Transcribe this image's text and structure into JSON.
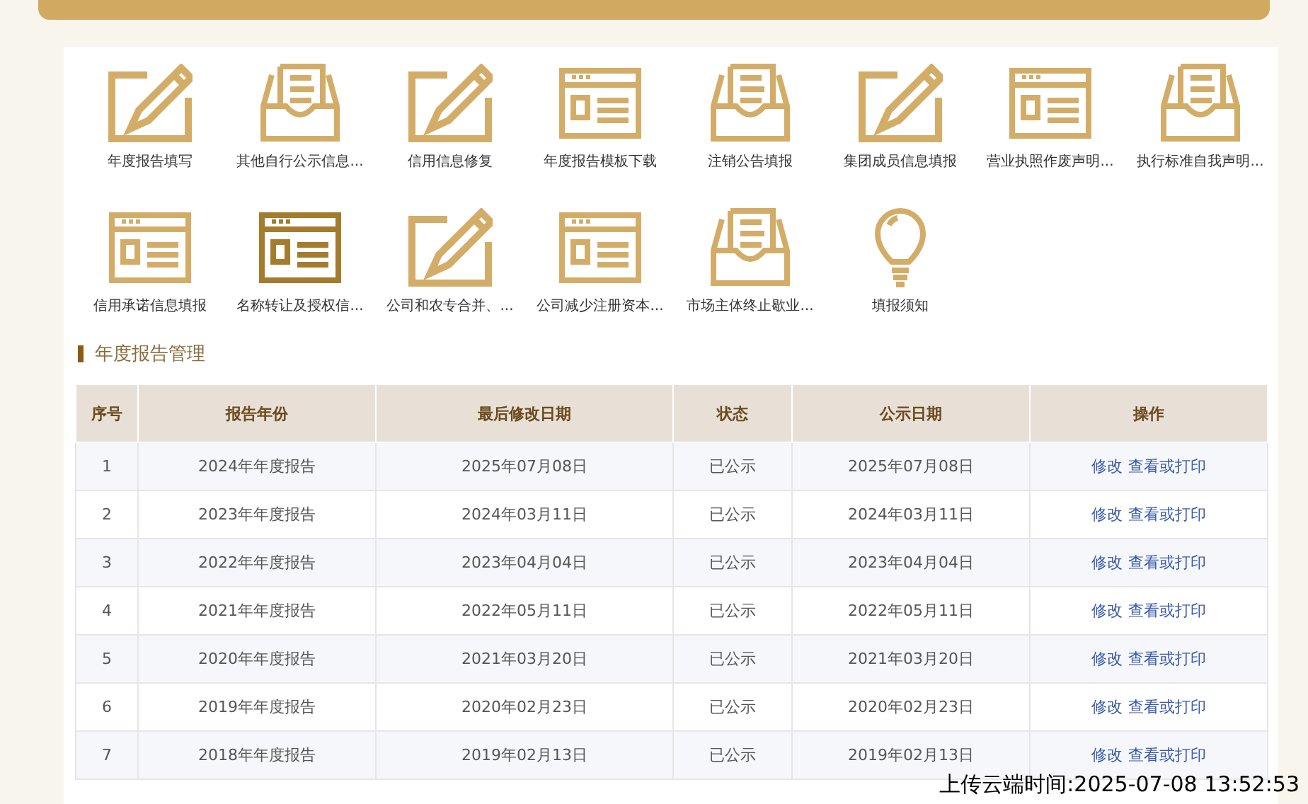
{
  "shortcuts": [
    {
      "label": "年度报告填写",
      "kind": "pencil",
      "selected": false
    },
    {
      "label": "其他自行公示信息...",
      "kind": "inbox",
      "selected": false
    },
    {
      "label": "信用信息修复",
      "kind": "pencil",
      "selected": false
    },
    {
      "label": "年度报告模板下载",
      "kind": "window",
      "selected": false
    },
    {
      "label": "注销公告填报",
      "kind": "inbox",
      "selected": false
    },
    {
      "label": "集团成员信息填报",
      "kind": "pencil",
      "selected": false
    },
    {
      "label": "营业执照作废声明...",
      "kind": "window",
      "selected": false
    },
    {
      "label": "执行标准自我声明...",
      "kind": "inbox",
      "selected": false
    },
    {
      "label": "信用承诺信息填报",
      "kind": "window",
      "selected": false
    },
    {
      "label": "名称转让及授权信...",
      "kind": "window",
      "selected": true
    },
    {
      "label": "公司和农专合并、...",
      "kind": "pencil",
      "selected": false
    },
    {
      "label": "公司减少注册资本...",
      "kind": "window",
      "selected": false
    },
    {
      "label": "市场主体终止歇业...",
      "kind": "inbox",
      "selected": false
    },
    {
      "label": "填报须知",
      "kind": "bulb",
      "selected": false
    }
  ],
  "section_title": "年度报告管理",
  "table": {
    "columns": [
      "序号",
      "报告年份",
      "最后修改日期",
      "状态",
      "公示日期",
      "操作"
    ],
    "rows": [
      {
        "cells": [
          "1",
          "2024年年度报告",
          "2025年07月08日",
          "已公示",
          "2025年07月08日"
        ],
        "actions": [
          "修改",
          "查看或打印"
        ]
      },
      {
        "cells": [
          "2",
          "2023年年度报告",
          "2024年03月11日",
          "已公示",
          "2024年03月11日"
        ],
        "actions": [
          "修改",
          "查看或打印"
        ]
      },
      {
        "cells": [
          "3",
          "2022年年度报告",
          "2023年04月04日",
          "已公示",
          "2023年04月04日"
        ],
        "actions": [
          "修改",
          "查看或打印"
        ]
      },
      {
        "cells": [
          "4",
          "2021年年度报告",
          "2022年05月11日",
          "已公示",
          "2022年05月11日"
        ],
        "actions": [
          "修改",
          "查看或打印"
        ]
      },
      {
        "cells": [
          "5",
          "2020年年度报告",
          "2021年03月20日",
          "已公示",
          "2021年03月20日"
        ],
        "actions": [
          "修改",
          "查看或打印"
        ]
      },
      {
        "cells": [
          "6",
          "2019年年度报告",
          "2020年02月23日",
          "已公示",
          "2020年02月23日"
        ],
        "actions": [
          "修改",
          "查看或打印"
        ]
      },
      {
        "cells": [
          "7",
          "2018年年度报告",
          "2019年02月13日",
          "已公示",
          "2019年02月13日"
        ],
        "actions": [
          "修改",
          "查看或打印"
        ]
      }
    ]
  },
  "upload_time": "上传云端时间:2025-07-08 13:52:53"
}
